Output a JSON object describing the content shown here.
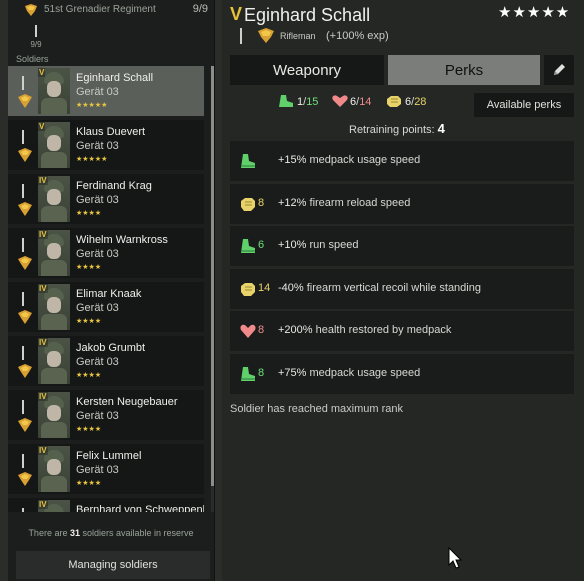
{
  "colors": {
    "gold": "#e6c23a",
    "green": "#6fe07a",
    "pink": "#f08a8a",
    "yellow": "#e8d26a",
    "selected_row": "#5a5f5a",
    "tab_active": "#7a7d79"
  },
  "sidebar": {
    "regiment": "51st Grenadier Regiment",
    "squad_count": "9/9",
    "squad_slot_label": "9/9",
    "soldiers_label": "Soldiers",
    "soldiers": [
      {
        "rank": "V",
        "name": "Eginhard Schall",
        "gear": "Gerät 03",
        "stars": "★★★★★",
        "selected": true
      },
      {
        "rank": "V",
        "name": "Klaus Duevert",
        "gear": "Gerät 03",
        "stars": "★★★★★"
      },
      {
        "rank": "IV",
        "name": "Ferdinand Krag",
        "gear": "Gerät 03",
        "stars": "★★★★"
      },
      {
        "rank": "IV",
        "name": "Wihelm Warnkross",
        "gear": "Gerät 03",
        "stars": "★★★★"
      },
      {
        "rank": "IV",
        "name": "Elimar Knaak",
        "gear": "Gerät 03",
        "stars": "★★★★"
      },
      {
        "rank": "IV",
        "name": "Jakob Grumbt",
        "gear": "Gerät 03",
        "stars": "★★★★"
      },
      {
        "rank": "IV",
        "name": "Kersten Neugebauer",
        "gear": "Gerät 03",
        "stars": "★★★★"
      },
      {
        "rank": "IV",
        "name": "Felix Lummel",
        "gear": "Gerät 03",
        "stars": "★★★★"
      },
      {
        "rank": "IV",
        "name": "Bernhard von Schweppenb",
        "gear": "",
        "stars": ""
      }
    ],
    "reserve_prefix": "There are ",
    "reserve_count": "31",
    "reserve_suffix": " soldiers available in reserve",
    "manage_label": "Managing soldiers"
  },
  "detail": {
    "rank": "V",
    "name": "Eginhard Schall",
    "stars": "★★★★★",
    "class": "Rifleman",
    "exp_bonus": "(+100% exp)",
    "tabs": [
      "Weaponry",
      "Perks"
    ],
    "active_tab": "Perks",
    "stats": {
      "green": {
        "current": "1",
        "total": "15"
      },
      "pink": {
        "current": "6",
        "total": "14"
      },
      "yellow": {
        "current": "6",
        "total": "28"
      }
    },
    "available_perks_label": "Available perks",
    "retraining_label": "Retraining points:",
    "retraining_value": "4",
    "perks": [
      {
        "icon": "green-boot-icon",
        "cost": "",
        "value": "+15%",
        "text": " medpack usage speed"
      },
      {
        "icon": "yellow-fist-icon",
        "cost": "8",
        "value": "+12%",
        "text": " firearm reload speed"
      },
      {
        "icon": "green-boot-icon",
        "cost": "6",
        "value": "+10%",
        "text": " run speed"
      },
      {
        "icon": "yellow-fist-icon",
        "cost": "14",
        "value": "-40%",
        "text": " firearm vertical recoil while standing"
      },
      {
        "icon": "pink-heart-icon",
        "cost": "8",
        "value": "+200%",
        "text": " health restored by medpack"
      },
      {
        "icon": "green-boot-icon",
        "cost": "8",
        "value": "+75%",
        "text": " medpack usage speed"
      }
    ],
    "max_rank_text": "Soldier has reached maximum rank"
  }
}
